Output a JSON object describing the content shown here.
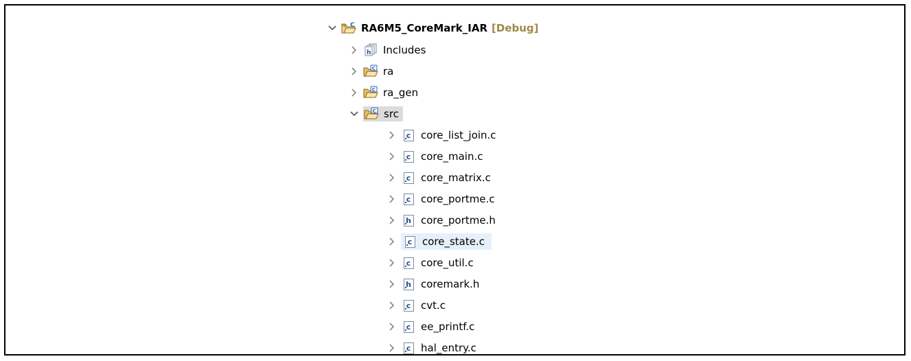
{
  "project": {
    "name": "RA6M5_CoreMark_IAR",
    "decoration": "[Debug]"
  },
  "folders": [
    {
      "label": "Includes",
      "icon": "includes-icon"
    },
    {
      "label": "ra",
      "icon": "source-folder-icon"
    },
    {
      "label": "ra_gen",
      "icon": "source-folder-icon"
    },
    {
      "label": "src",
      "icon": "source-folder-icon"
    }
  ],
  "files": [
    {
      "label": "core_list_join.c",
      "type": "c"
    },
    {
      "label": "core_main.c",
      "type": "c"
    },
    {
      "label": "core_matrix.c",
      "type": "c"
    },
    {
      "label": "core_portme.c",
      "type": "c"
    },
    {
      "label": "core_portme.h",
      "type": "h"
    },
    {
      "label": "core_state.c",
      "type": "c"
    },
    {
      "label": "core_util.c",
      "type": "c"
    },
    {
      "label": "coremark.h",
      "type": "h"
    },
    {
      "label": "cvt.c",
      "type": "c"
    },
    {
      "label": "ee_printf.c",
      "type": "c"
    },
    {
      "label": "hal_entry.c",
      "type": "c"
    }
  ],
  "file_badges": {
    "c": "c",
    "h": "h"
  },
  "colors": {
    "decoration": "#a08848",
    "hover": "#e5f0fa",
    "selected": "#dcdcdc"
  }
}
